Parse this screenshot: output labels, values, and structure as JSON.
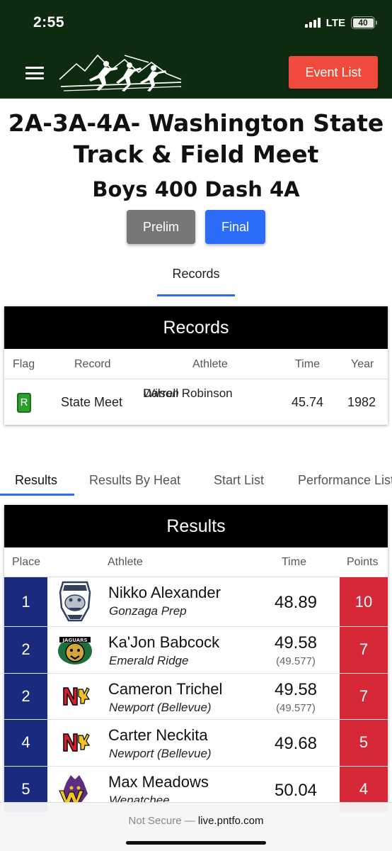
{
  "status": {
    "time": "2:55",
    "network": "LTE",
    "battery": "40"
  },
  "header": {
    "event_list_label": "Event List"
  },
  "meet": {
    "title_line1": "2A-3A-4A- Washington State",
    "title_line2": "Track & Field Meet",
    "event": "Boys 400 Dash 4A"
  },
  "round_buttons": {
    "prelim": "Prelim",
    "final": "Final"
  },
  "records_tab": "Records",
  "records": {
    "heading": "Records",
    "columns": [
      "Flag",
      "Record",
      "Athlete",
      "Time",
      "Year"
    ],
    "rows": [
      {
        "flag": "R",
        "record": "State Meet",
        "athlete": "Darrell Robinson",
        "school": "Wilson",
        "time": "45.74",
        "year": "1982"
      }
    ]
  },
  "tabs": [
    "Results",
    "Results By Heat",
    "Start List",
    "Performance List"
  ],
  "results": {
    "heading": "Results",
    "columns": [
      "Place",
      "Athlete",
      "Time",
      "Points"
    ],
    "rows": [
      {
        "place": "1",
        "athlete": "Nikko Alexander",
        "school": "Gonzaga Prep",
        "time": "48.89",
        "time_detail": "",
        "points": "10",
        "logo": "bulldog-logo"
      },
      {
        "place": "2",
        "athlete": "Ka'Jon Babcock",
        "school": "Emerald Ridge",
        "time": "49.58",
        "time_detail": "(49.577)",
        "points": "7",
        "logo": "jaguars-logo"
      },
      {
        "place": "2",
        "athlete": "Cameron Trichel",
        "school": "Newport (Bellevue)",
        "time": "49.58",
        "time_detail": "(49.577)",
        "points": "7",
        "logo": "newport-logo"
      },
      {
        "place": "4",
        "athlete": "Carter Neckita",
        "school": "Newport (Bellevue)",
        "time": "49.68",
        "time_detail": "",
        "points": "5",
        "logo": "newport-logo"
      },
      {
        "place": "5",
        "athlete": "Max Meadows",
        "school": "Wenatchee",
        "time": "50.04",
        "time_detail": "",
        "points": "4",
        "logo": "wenatchee-logo"
      }
    ]
  },
  "browser": {
    "security": "Not Secure —",
    "domain": "live.pntfo.com"
  },
  "colors": {
    "header_bg": "#0f2b0f",
    "event_btn": "#f04a3c",
    "final_btn": "#2b6df6",
    "prelim_btn": "#777777",
    "place_bg": "#1a2a7e",
    "points_bg": "#d62837"
  }
}
